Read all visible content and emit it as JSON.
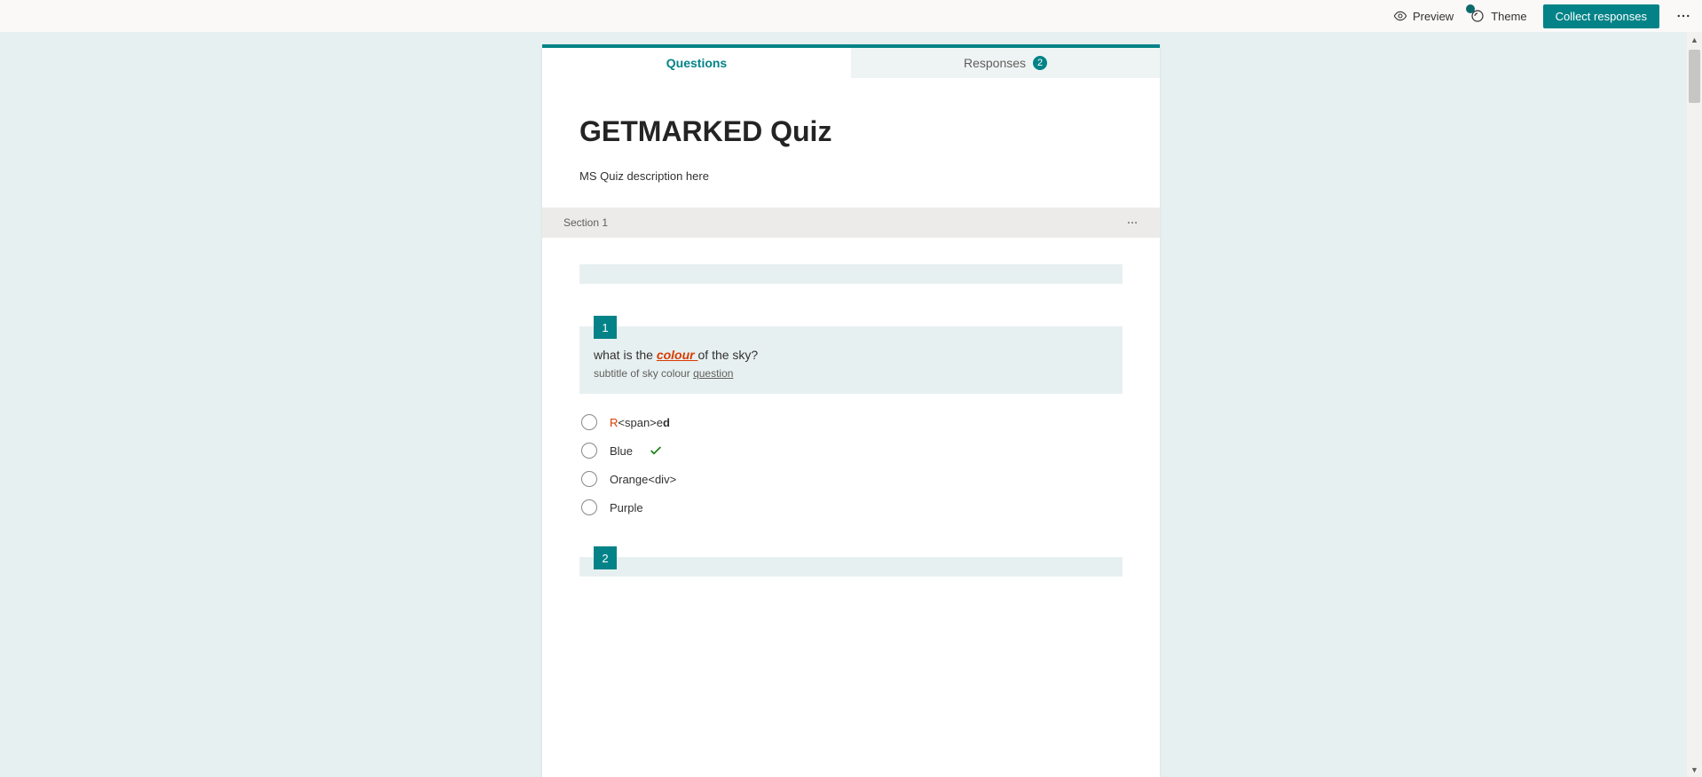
{
  "topbar": {
    "preview": "Preview",
    "theme": "Theme",
    "collect": "Collect responses"
  },
  "tabs": {
    "questions": "Questions",
    "responses": "Responses",
    "responses_count": "2"
  },
  "form": {
    "title": "GETMARKED Quiz",
    "description": "MS Quiz description here"
  },
  "section": {
    "label": "Section 1"
  },
  "questions": [
    {
      "number": "1",
      "title_prefix": "what is the ",
      "title_colour_word": "colour ",
      "title_suffix": "of the sky?",
      "subtitle_prefix": "subtitle of sky colour ",
      "subtitle_underline": "question",
      "options": {
        "opt1_r": "R",
        "opt1_mid": "<span>e",
        "opt1_bold": "d",
        "opt2": "Blue",
        "opt3": "Orange<div>",
        "opt4": "Purple"
      }
    },
    {
      "number": "2"
    }
  ]
}
